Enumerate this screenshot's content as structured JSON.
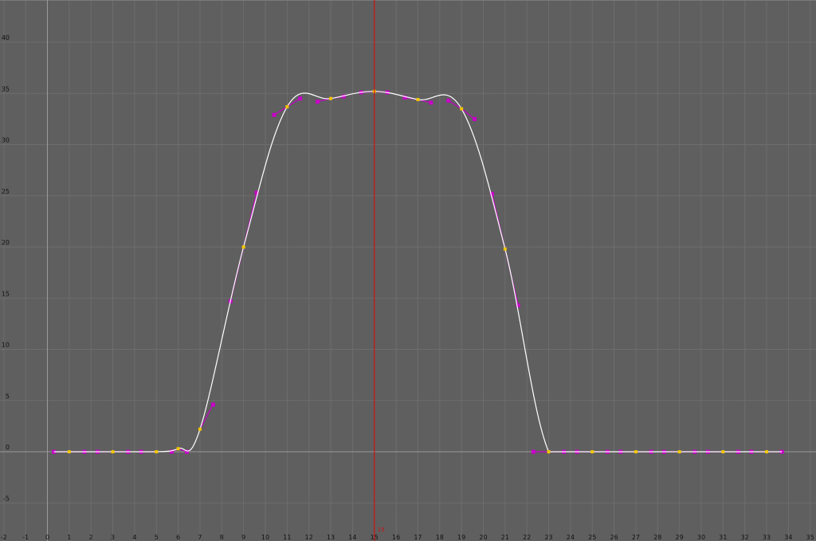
{
  "window": {
    "title": ""
  },
  "graph_editor": {
    "current_frame": "15",
    "colors": {
      "background": "#5f5f5f",
      "grid": "#6d6d6d",
      "axis": "#9a9a9a",
      "curve": "#ffffff",
      "key": "#f2c400",
      "tangent": "#c800c8",
      "playhead": "#cc1111",
      "text": "#111111"
    },
    "x_ticks": [
      "-2",
      "-1",
      "0",
      "1",
      "2",
      "3",
      "4",
      "5",
      "6",
      "7",
      "8",
      "9",
      "10",
      "11",
      "12",
      "13",
      "14",
      "15",
      "16",
      "17",
      "18",
      "19",
      "20",
      "21",
      "22",
      "23",
      "24",
      "25",
      "26",
      "27",
      "28",
      "29",
      "30",
      "31",
      "32",
      "33",
      "34",
      "35"
    ],
    "y_ticks": [
      "-5",
      "0",
      "5",
      "10",
      "15",
      "20",
      "25",
      "30",
      "35",
      "40"
    ]
  },
  "chart_data": {
    "type": "line",
    "title": "",
    "xlabel": "",
    "ylabel": "",
    "xlim": [
      -2,
      35
    ],
    "ylim": [
      -8,
      43
    ],
    "x_ticks": [
      -2,
      -1,
      0,
      1,
      2,
      3,
      4,
      5,
      6,
      7,
      8,
      9,
      10,
      11,
      12,
      13,
      14,
      15,
      16,
      17,
      18,
      19,
      20,
      21,
      22,
      23,
      24,
      25,
      26,
      27,
      28,
      29,
      30,
      31,
      32,
      33,
      34,
      35
    ],
    "y_ticks": [
      -5,
      0,
      5,
      10,
      15,
      20,
      25,
      30,
      35,
      40
    ],
    "grid": true,
    "playhead_frame": 15,
    "series": [
      {
        "keys": [
          {
            "x": 1,
            "y": 0
          },
          {
            "x": 3,
            "y": 0
          },
          {
            "x": 5,
            "y": 0
          },
          {
            "x": 6,
            "y": 0.3
          },
          {
            "x": 7,
            "y": 2.2
          },
          {
            "x": 9,
            "y": 20
          },
          {
            "x": 11,
            "y": 33.7
          },
          {
            "x": 13,
            "y": 34.5
          },
          {
            "x": 15,
            "y": 35.2
          },
          {
            "x": 17,
            "y": 34.4
          },
          {
            "x": 19,
            "y": 33.5
          },
          {
            "x": 21,
            "y": 19.8
          },
          {
            "x": 23,
            "y": 0
          },
          {
            "x": 25,
            "y": 0
          },
          {
            "x": 27,
            "y": 0
          },
          {
            "x": 29,
            "y": 0
          },
          {
            "x": 31,
            "y": 0
          },
          {
            "x": 33,
            "y": 0
          }
        ],
        "tangent_handles": [
          {
            "x": 0.3,
            "y": 0
          },
          {
            "x": 1.7,
            "y": 0
          },
          {
            "x": 2.3,
            "y": 0
          },
          {
            "x": 3.7,
            "y": 0
          },
          {
            "x": 4.3,
            "y": 0
          },
          {
            "x": 5.7,
            "y": 0
          },
          {
            "x": 6.4,
            "y": 0
          },
          {
            "x": 7.6,
            "y": 4.6
          },
          {
            "x": 8.4,
            "y": 14.7
          },
          {
            "x": 9.6,
            "y": 25.3
          },
          {
            "x": 10.4,
            "y": 32.9
          },
          {
            "x": 11.6,
            "y": 34.5
          },
          {
            "x": 12.4,
            "y": 34.2
          },
          {
            "x": 13.6,
            "y": 34.7
          },
          {
            "x": 14.4,
            "y": 35.1
          },
          {
            "x": 15.6,
            "y": 35.1
          },
          {
            "x": 16.4,
            "y": 34.6
          },
          {
            "x": 17.6,
            "y": 34.1
          },
          {
            "x": 18.4,
            "y": 34.3
          },
          {
            "x": 19.6,
            "y": 32.5
          },
          {
            "x": 20.4,
            "y": 25.2
          },
          {
            "x": 21.6,
            "y": 14.3
          },
          {
            "x": 22.3,
            "y": 0
          },
          {
            "x": 23.7,
            "y": 0
          },
          {
            "x": 24.3,
            "y": 0
          },
          {
            "x": 25.7,
            "y": 0
          },
          {
            "x": 26.3,
            "y": 0
          },
          {
            "x": 27.7,
            "y": 0
          },
          {
            "x": 28.3,
            "y": 0
          },
          {
            "x": 29.7,
            "y": 0
          },
          {
            "x": 30.3,
            "y": 0
          },
          {
            "x": 31.7,
            "y": 0
          },
          {
            "x": 32.3,
            "y": 0
          },
          {
            "x": 33.7,
            "y": 0
          }
        ]
      }
    ]
  }
}
